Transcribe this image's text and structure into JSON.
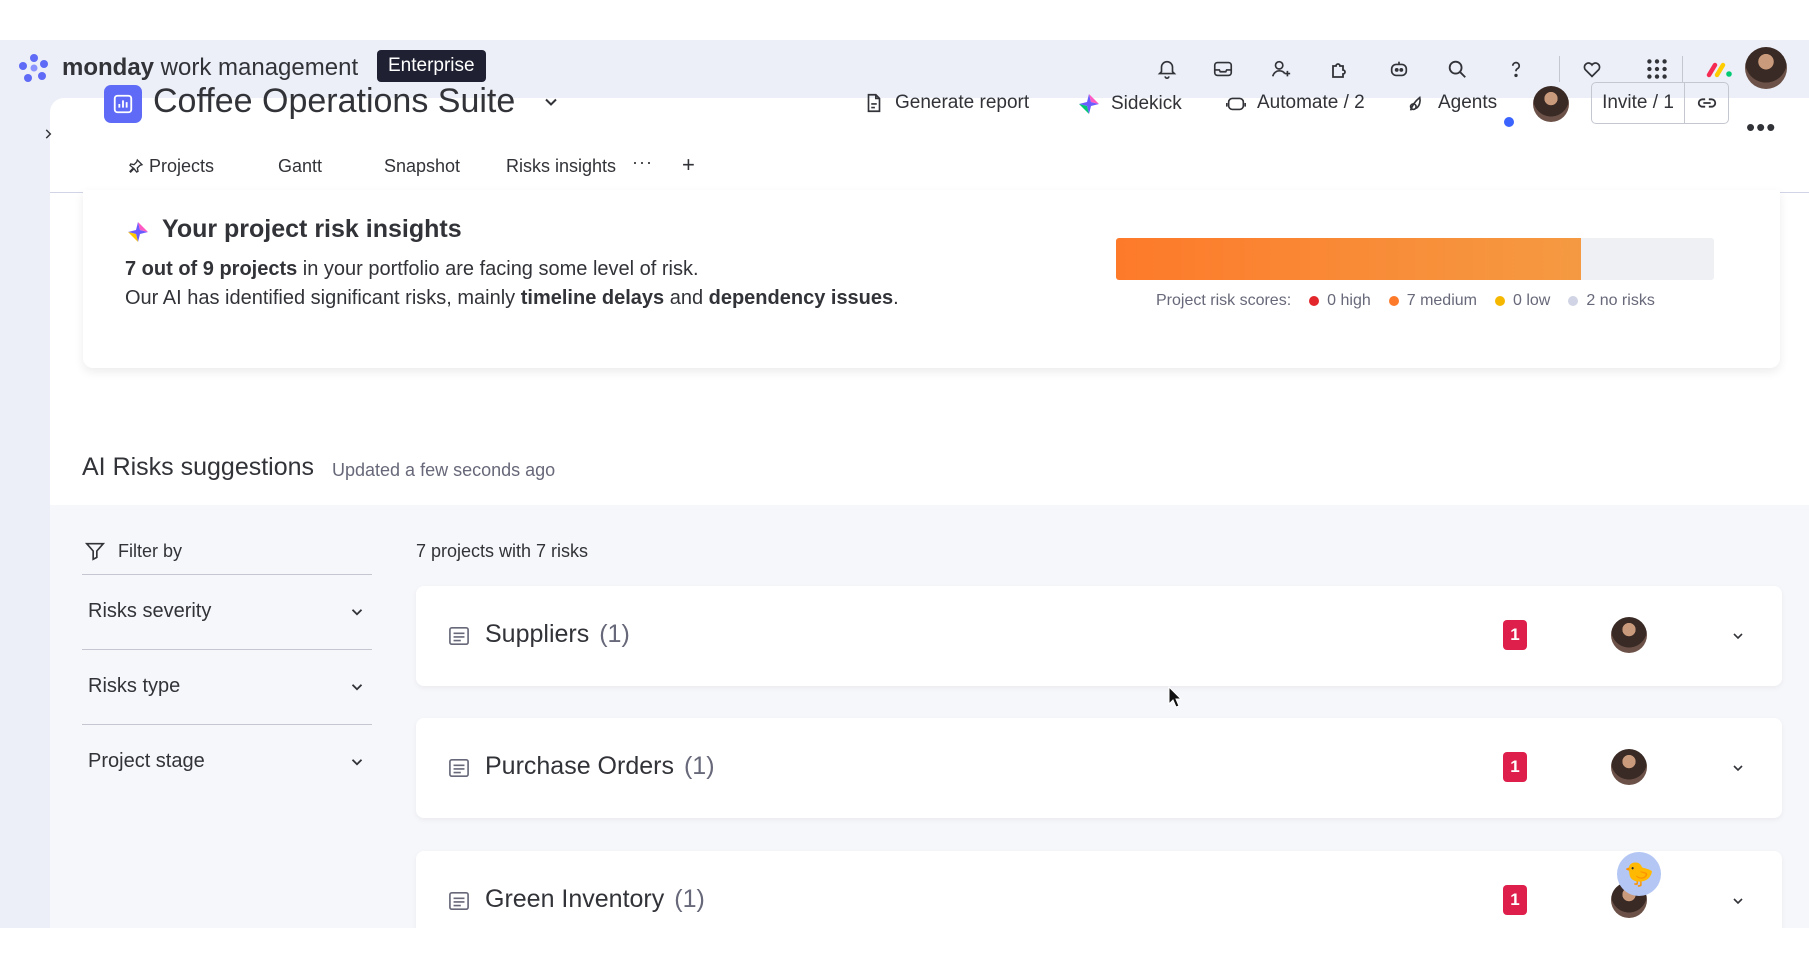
{
  "topbar": {
    "brand_bold": "monday",
    "brand_rest": " work management",
    "plan_badge": "Enterprise",
    "icons": [
      "bell-icon",
      "inbox-icon",
      "invite-members-icon",
      "apps-icon",
      "bot-icon",
      "search-icon",
      "help-icon",
      "favorites-icon",
      "app-grid-icon",
      "monday-logo-icon",
      "user-avatar"
    ]
  },
  "board": {
    "title": "Coffee Operations Suite",
    "actions": {
      "generate_report": "Generate report",
      "sidekick": "Sidekick",
      "automate": "Automate / 2",
      "agents": "Agents",
      "invite": "Invite / 1"
    },
    "tabs": [
      "Projects",
      "Gantt",
      "Snapshot",
      "Risks insights"
    ]
  },
  "insights": {
    "title": "Your project risk insights",
    "line1_bold": "7 out of 9 projects",
    "line1_rest": " in your portfolio are facing some level of risk.",
    "line2_a": "Our AI has identified significant risks, mainly ",
    "line2_b": "timeline delays",
    "line2_c": " and ",
    "line2_d": "dependency issues",
    "line2_e": ".",
    "risk_fraction": 0.7778,
    "legend_label": "Project risk scores:",
    "legend": [
      {
        "label": "0 high",
        "color": "#e2262c"
      },
      {
        "label": "7 medium",
        "color": "#fd7a2a"
      },
      {
        "label": "0 low",
        "color": "#f5b700"
      },
      {
        "label": "2 no risks",
        "color": "#d0d4e4"
      }
    ]
  },
  "suggestions": {
    "title": "AI Risks suggestions",
    "updated": "Updated a few seconds ago",
    "filter_label": "Filter by",
    "filters": [
      "Risks severity",
      "Risks type",
      "Project stage"
    ],
    "count_label": "7 projects with 7 risks",
    "projects": [
      {
        "name": "Suppliers",
        "count": "(1)",
        "risks": "1"
      },
      {
        "name": "Purchase Orders",
        "count": "(1)",
        "risks": "1"
      },
      {
        "name": "Green Inventory",
        "count": "(1)",
        "risks": "1"
      }
    ]
  },
  "colors": {
    "accent": "#0073ea",
    "board_icon": "#5f6bf6",
    "risk_badge": "#df1f4b",
    "bar_fill": "#fd7a2a"
  }
}
